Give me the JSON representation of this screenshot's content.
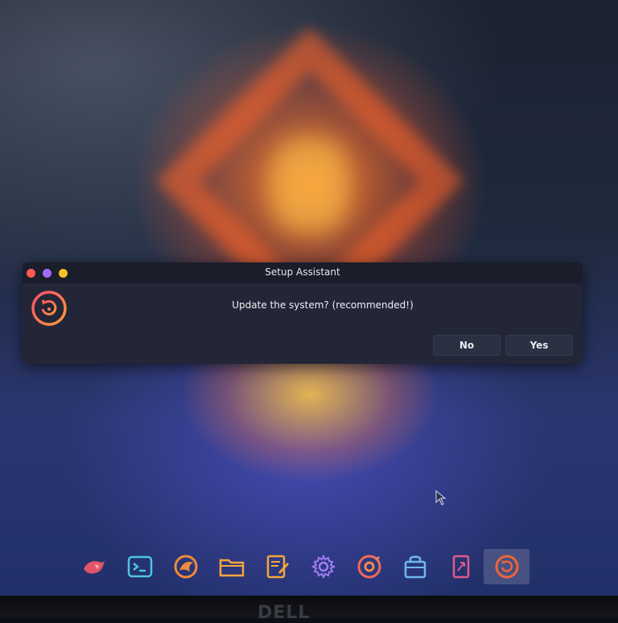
{
  "dialog": {
    "title": "Setup Assistant",
    "message": "Update the system? (recommended!)",
    "no_label": "No",
    "yes_label": "Yes",
    "icon": "update-refresh-icon"
  },
  "window_controls": [
    "close",
    "minimize",
    "maximize"
  ],
  "dock": {
    "items": [
      {
        "name": "eagle-app-icon"
      },
      {
        "name": "terminal-icon"
      },
      {
        "name": "browser-icon"
      },
      {
        "name": "folder-icon"
      },
      {
        "name": "text-editor-icon"
      },
      {
        "name": "settings-gear-icon"
      },
      {
        "name": "timeshift-icon"
      },
      {
        "name": "store-bag-icon"
      },
      {
        "name": "installer-icon"
      },
      {
        "name": "setup-assistant-icon"
      }
    ]
  },
  "monitor_brand": "DELL",
  "colors": {
    "accent": "#f0643c",
    "dialog_bg": "#222636",
    "titlebar_bg": "#1a1d2a",
    "close": "#ff5a52",
    "minimize": "#a36cf5",
    "maximize": "#f5c12a"
  }
}
